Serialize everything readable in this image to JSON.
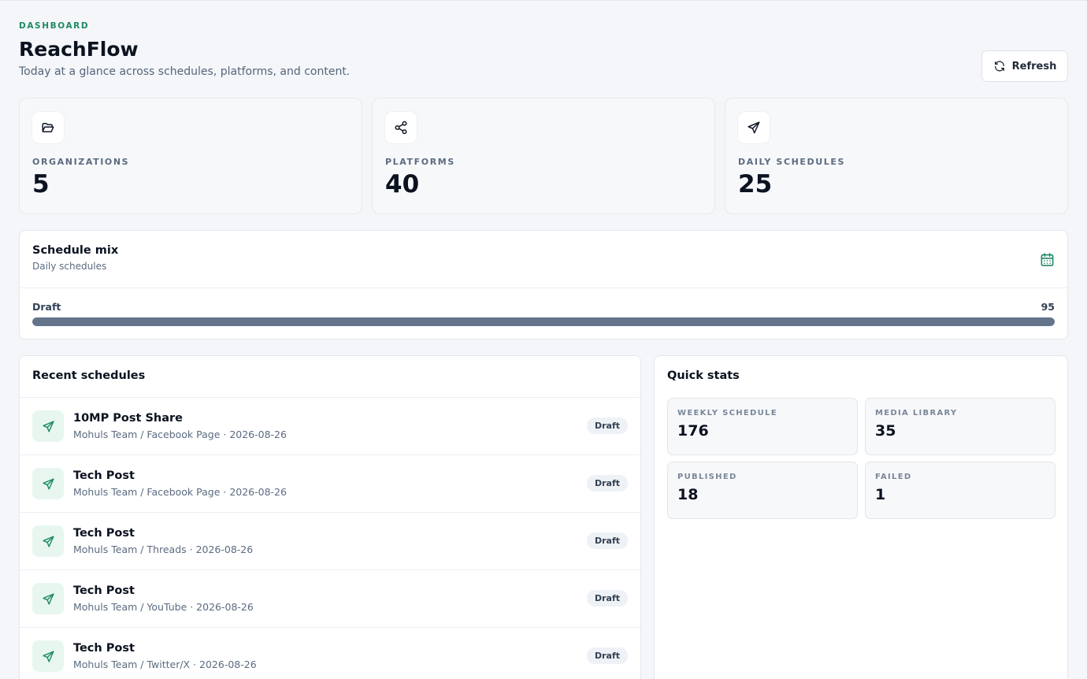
{
  "header": {
    "eyebrow": "DASHBOARD",
    "title": "ReachFlow",
    "subtitle": "Today at a glance across schedules, platforms, and content.",
    "refresh_label": "Refresh"
  },
  "stats": [
    {
      "icon": "folder-icon",
      "label": "ORGANIZATIONS",
      "value": "5"
    },
    {
      "icon": "share-icon",
      "label": "PLATFORMS",
      "value": "40"
    },
    {
      "icon": "send-icon",
      "label": "DAILY SCHEDULES",
      "value": "25"
    }
  ],
  "schedule_mix": {
    "title": "Schedule mix",
    "subtitle": "Daily schedules",
    "icon": "calendar-icon",
    "bar": {
      "label": "Draft",
      "value": "95",
      "fill_fraction": 1.0
    }
  },
  "recent": {
    "title": "Recent schedules",
    "items": [
      {
        "title": "10MP Post Share",
        "meta": "Mohuls Team / Facebook Page · 2026-08-26",
        "status": "Draft"
      },
      {
        "title": "Tech Post",
        "meta": "Mohuls Team / Facebook Page · 2026-08-26",
        "status": "Draft"
      },
      {
        "title": "Tech Post",
        "meta": "Mohuls Team / Threads · 2026-08-26",
        "status": "Draft"
      },
      {
        "title": "Tech Post",
        "meta": "Mohuls Team / YouTube · 2026-08-26",
        "status": "Draft"
      },
      {
        "title": "Tech Post",
        "meta": "Mohuls Team / Twitter/X · 2026-08-26",
        "status": "Draft"
      }
    ]
  },
  "quick_stats": {
    "title": "Quick stats",
    "tiles": [
      {
        "label": "WEEKLY SCHEDULE",
        "value": "176"
      },
      {
        "label": "MEDIA LIBRARY",
        "value": "35"
      },
      {
        "label": "PUBLISHED",
        "value": "18"
      },
      {
        "label": "FAILED",
        "value": "1"
      }
    ]
  },
  "colors": {
    "accent": "#1f8a63",
    "bar_fill": "#64748b",
    "background": "#f4f6f9"
  }
}
